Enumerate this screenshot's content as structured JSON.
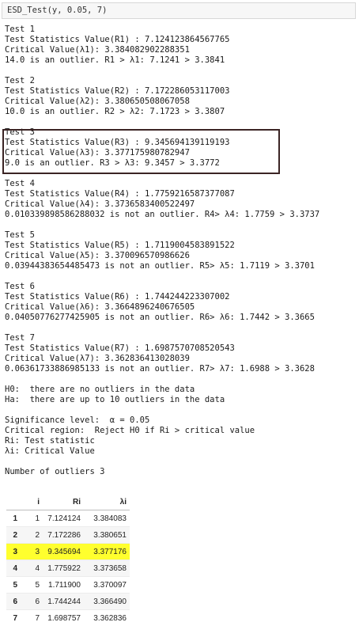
{
  "cell": {
    "code": "ESD_Test(y, 0.05, 7)"
  },
  "output": {
    "tests": [
      {
        "title": "Test 1",
        "stat": "Test Statistics Value(R1) : 7.124123864567765",
        "crit": "Critical Value(λ1): 3.384082902288351",
        "result": "14.0 is an outlier. R1 > λ1: 7.1241 > 3.3841"
      },
      {
        "title": "Test 2",
        "stat": "Test Statistics Value(R2) : 7.172286053117003",
        "crit": "Critical Value(λ2): 3.380650508067058",
        "result": "10.0 is an outlier. R2 > λ2: 7.1723 > 3.3807"
      },
      {
        "title": "Test 3",
        "stat": "Test Statistics Value(R3) : 9.345694139119193",
        "crit": "Critical Value(λ3): 3.377175980782947",
        "result": "9.0 is an outlier. R3 > λ3: 9.3457 > 3.3772"
      },
      {
        "title": "Test 4",
        "stat": "Test Statistics Value(R4) : 1.7759216587377087",
        "crit": "Critical Value(λ4): 3.3736583400522497",
        "result": "0.010339898586288032 is not an outlier. R4> λ4: 1.7759 > 3.3737"
      },
      {
        "title": "Test 5",
        "stat": "Test Statistics Value(R5) : 1.7119004583891522",
        "crit": "Critical Value(λ5): 3.370096570986626",
        "result": "0.03944383654485473 is not an outlier. R5> λ5: 1.7119 > 3.3701"
      },
      {
        "title": "Test 6",
        "stat": "Test Statistics Value(R6) : 1.744244223307002",
        "crit": "Critical Value(λ6): 3.3664896240676505",
        "result": "0.04050776277425905 is not an outlier. R6> λ6: 1.7442 > 3.3665"
      },
      {
        "title": "Test 7",
        "stat": "Test Statistics Value(R7) : 1.6987570708520543",
        "crit": "Critical Value(λ7): 3.362836413028039",
        "result": "0.06361733886985133 is not an outlier. R7> λ7: 1.6988 > 3.3628"
      }
    ],
    "h0": "H0:  there are no outliers in the data",
    "ha": "Ha:  there are up to 10 outliers in the data",
    "sig": "Significance level:  α = 0.05",
    "region": "Critical region:  Reject H0 if Ri > critical value",
    "ri_def": "Ri: Test statistic",
    "li_def": "λi: Critical Value",
    "n_outliers": "Number of outliers 3"
  },
  "table": {
    "headers": [
      "",
      "i",
      "Ri",
      "λi"
    ],
    "rows": [
      [
        "1",
        "1",
        "7.124124",
        "3.384083"
      ],
      [
        "2",
        "2",
        "7.172286",
        "3.380651"
      ],
      [
        "3",
        "3",
        "9.345694",
        "3.377176"
      ],
      [
        "4",
        "4",
        "1.775922",
        "3.373658"
      ],
      [
        "5",
        "5",
        "1.711900",
        "3.370097"
      ],
      [
        "6",
        "6",
        "1.744244",
        "3.366490"
      ],
      [
        "7",
        "7",
        "1.698757",
        "3.362836"
      ]
    ],
    "highlight_color": "#ffff2e"
  }
}
